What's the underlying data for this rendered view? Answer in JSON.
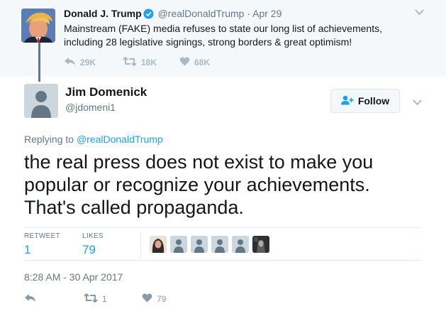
{
  "parent_tweet": {
    "author_name": "Donald J. Trump",
    "author_handle": "@realDonaldTrump",
    "separator": "·",
    "date": "Apr 29",
    "text": "Mainstream (FAKE) media refuses to state our long list of achievements, including 28 legislative signings, strong borders & great optimism!",
    "reply_count": "29K",
    "retweet_count": "18K",
    "like_count": "68K",
    "verified": true
  },
  "main_tweet": {
    "author_name": "Jim Domenick",
    "author_handle": "@jdomeni1",
    "follow_label": "Follow",
    "replying_prefix": "Replying to",
    "replying_to": "@realDonaldTrump",
    "text": "the real press does not exist to make you popular or recognize your achievements. That's called propaganda.",
    "stats": {
      "retweets_label": "RETWEET",
      "retweets_value": "1",
      "likes_label": "LIKES",
      "likes_value": "79"
    },
    "timestamp": "8:28 AM - 30 Apr 2017",
    "action_retweet_count": "1",
    "action_like_count": "79"
  },
  "icons": {
    "reply": "reply-icon",
    "retweet": "retweet-icon",
    "like": "heart-icon",
    "verified": "verified-badge-icon",
    "follow": "add-user-icon",
    "more": "chevron-down-icon"
  },
  "colors": {
    "accent": "#1da1f2",
    "parent_bg": "#f5f8fa",
    "muted": "#657786",
    "thread_line": "#657786"
  }
}
